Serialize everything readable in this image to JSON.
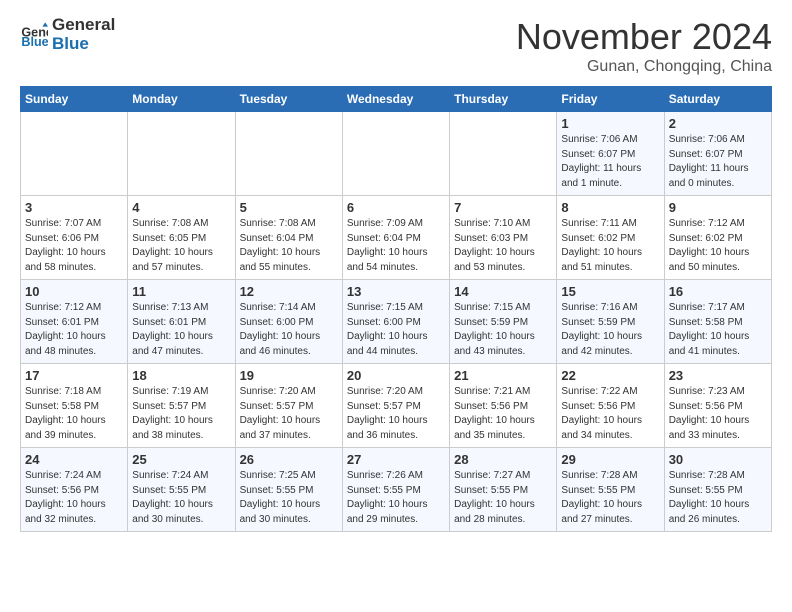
{
  "header": {
    "logo_line1": "General",
    "logo_line2": "Blue",
    "month": "November 2024",
    "location": "Gunan, Chongqing, China"
  },
  "weekdays": [
    "Sunday",
    "Monday",
    "Tuesday",
    "Wednesday",
    "Thursday",
    "Friday",
    "Saturday"
  ],
  "weeks": [
    [
      {
        "day": "",
        "info": ""
      },
      {
        "day": "",
        "info": ""
      },
      {
        "day": "",
        "info": ""
      },
      {
        "day": "",
        "info": ""
      },
      {
        "day": "",
        "info": ""
      },
      {
        "day": "1",
        "info": "Sunrise: 7:06 AM\nSunset: 6:07 PM\nDaylight: 11 hours\nand 1 minute."
      },
      {
        "day": "2",
        "info": "Sunrise: 7:06 AM\nSunset: 6:07 PM\nDaylight: 11 hours\nand 0 minutes."
      }
    ],
    [
      {
        "day": "3",
        "info": "Sunrise: 7:07 AM\nSunset: 6:06 PM\nDaylight: 10 hours\nand 58 minutes."
      },
      {
        "day": "4",
        "info": "Sunrise: 7:08 AM\nSunset: 6:05 PM\nDaylight: 10 hours\nand 57 minutes."
      },
      {
        "day": "5",
        "info": "Sunrise: 7:08 AM\nSunset: 6:04 PM\nDaylight: 10 hours\nand 55 minutes."
      },
      {
        "day": "6",
        "info": "Sunrise: 7:09 AM\nSunset: 6:04 PM\nDaylight: 10 hours\nand 54 minutes."
      },
      {
        "day": "7",
        "info": "Sunrise: 7:10 AM\nSunset: 6:03 PM\nDaylight: 10 hours\nand 53 minutes."
      },
      {
        "day": "8",
        "info": "Sunrise: 7:11 AM\nSunset: 6:02 PM\nDaylight: 10 hours\nand 51 minutes."
      },
      {
        "day": "9",
        "info": "Sunrise: 7:12 AM\nSunset: 6:02 PM\nDaylight: 10 hours\nand 50 minutes."
      }
    ],
    [
      {
        "day": "10",
        "info": "Sunrise: 7:12 AM\nSunset: 6:01 PM\nDaylight: 10 hours\nand 48 minutes."
      },
      {
        "day": "11",
        "info": "Sunrise: 7:13 AM\nSunset: 6:01 PM\nDaylight: 10 hours\nand 47 minutes."
      },
      {
        "day": "12",
        "info": "Sunrise: 7:14 AM\nSunset: 6:00 PM\nDaylight: 10 hours\nand 46 minutes."
      },
      {
        "day": "13",
        "info": "Sunrise: 7:15 AM\nSunset: 6:00 PM\nDaylight: 10 hours\nand 44 minutes."
      },
      {
        "day": "14",
        "info": "Sunrise: 7:15 AM\nSunset: 5:59 PM\nDaylight: 10 hours\nand 43 minutes."
      },
      {
        "day": "15",
        "info": "Sunrise: 7:16 AM\nSunset: 5:59 PM\nDaylight: 10 hours\nand 42 minutes."
      },
      {
        "day": "16",
        "info": "Sunrise: 7:17 AM\nSunset: 5:58 PM\nDaylight: 10 hours\nand 41 minutes."
      }
    ],
    [
      {
        "day": "17",
        "info": "Sunrise: 7:18 AM\nSunset: 5:58 PM\nDaylight: 10 hours\nand 39 minutes."
      },
      {
        "day": "18",
        "info": "Sunrise: 7:19 AM\nSunset: 5:57 PM\nDaylight: 10 hours\nand 38 minutes."
      },
      {
        "day": "19",
        "info": "Sunrise: 7:20 AM\nSunset: 5:57 PM\nDaylight: 10 hours\nand 37 minutes."
      },
      {
        "day": "20",
        "info": "Sunrise: 7:20 AM\nSunset: 5:57 PM\nDaylight: 10 hours\nand 36 minutes."
      },
      {
        "day": "21",
        "info": "Sunrise: 7:21 AM\nSunset: 5:56 PM\nDaylight: 10 hours\nand 35 minutes."
      },
      {
        "day": "22",
        "info": "Sunrise: 7:22 AM\nSunset: 5:56 PM\nDaylight: 10 hours\nand 34 minutes."
      },
      {
        "day": "23",
        "info": "Sunrise: 7:23 AM\nSunset: 5:56 PM\nDaylight: 10 hours\nand 33 minutes."
      }
    ],
    [
      {
        "day": "24",
        "info": "Sunrise: 7:24 AM\nSunset: 5:56 PM\nDaylight: 10 hours\nand 32 minutes."
      },
      {
        "day": "25",
        "info": "Sunrise: 7:24 AM\nSunset: 5:55 PM\nDaylight: 10 hours\nand 30 minutes."
      },
      {
        "day": "26",
        "info": "Sunrise: 7:25 AM\nSunset: 5:55 PM\nDaylight: 10 hours\nand 30 minutes."
      },
      {
        "day": "27",
        "info": "Sunrise: 7:26 AM\nSunset: 5:55 PM\nDaylight: 10 hours\nand 29 minutes."
      },
      {
        "day": "28",
        "info": "Sunrise: 7:27 AM\nSunset: 5:55 PM\nDaylight: 10 hours\nand 28 minutes."
      },
      {
        "day": "29",
        "info": "Sunrise: 7:28 AM\nSunset: 5:55 PM\nDaylight: 10 hours\nand 27 minutes."
      },
      {
        "day": "30",
        "info": "Sunrise: 7:28 AM\nSunset: 5:55 PM\nDaylight: 10 hours\nand 26 minutes."
      }
    ]
  ]
}
